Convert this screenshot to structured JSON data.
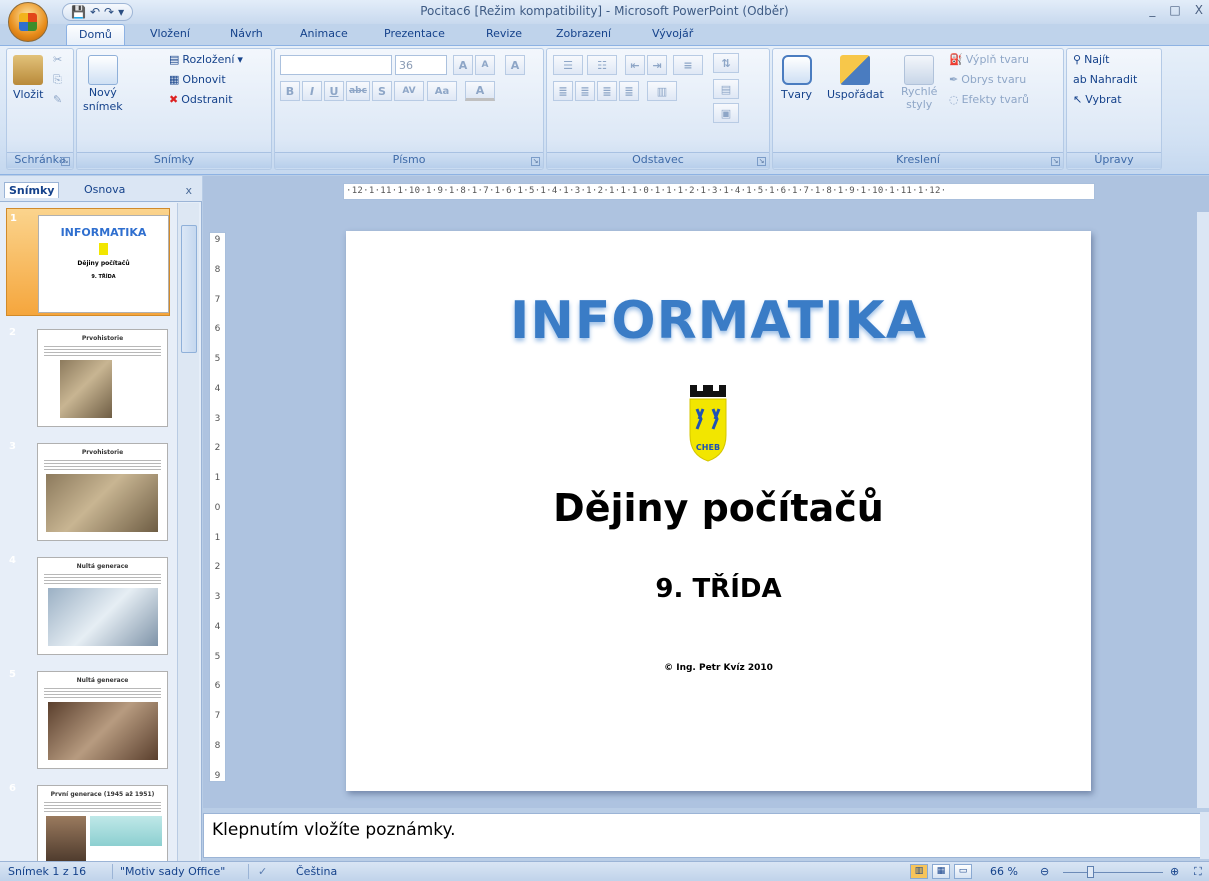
{
  "window": {
    "title": "Pocitac6 [Režim kompatibility] - Microsoft PowerPoint (Odběr)",
    "controls": [
      "_",
      "□",
      "X"
    ],
    "qat": [
      "💾",
      "↶",
      "↷",
      "▾"
    ]
  },
  "tabs": [
    "Domů",
    "Vložení",
    "Návrh",
    "Animace",
    "Prezentace",
    "Revize",
    "Zobrazení",
    "Vývojář"
  ],
  "active_tab": "Domů",
  "ribbon": {
    "clipboard": {
      "title": "Schránka",
      "paste": "Vložit"
    },
    "slides": {
      "title": "Snímky",
      "new_slide_1": "Nový",
      "new_slide_2": "snímek",
      "layout": "Rozložení",
      "reset": "Obnovit",
      "delete": "Odstranit"
    },
    "font": {
      "title": "Písmo",
      "size": "36",
      "bold": "B",
      "italic": "I",
      "underline": "U",
      "strike": "abc",
      "shadow": "S",
      "spacing": "AV",
      "case": "Aa",
      "grow": "A",
      "shrink": "A",
      "clear": "A",
      "color": "A"
    },
    "paragraph": {
      "title": "Odstavec"
    },
    "drawing": {
      "title": "Kreslení",
      "shapes": "Tvary",
      "arrange": "Uspořádat",
      "quick_styles_1": "Rychlé",
      "quick_styles_2": "styly",
      "fill": "Výplň tvaru",
      "outline": "Obrys tvaru",
      "effects": "Efekty tvarů"
    },
    "editing": {
      "title": "Úpravy",
      "find": "Najít",
      "replace": "Nahradit",
      "select": "Vybrat"
    }
  },
  "left_pane": {
    "tab_slides": "Snímky",
    "tab_outline": "Osnova",
    "close": "x",
    "thumbnails": [
      {
        "num": "1",
        "title": "INFORMATIKA",
        "subtitle": "Dějiny počítačů",
        "class": "9. TŘÍDA"
      },
      {
        "num": "2",
        "title": "Prvohistorie"
      },
      {
        "num": "3",
        "title": "Prvohistorie"
      },
      {
        "num": "4",
        "title": "Nultá generace"
      },
      {
        "num": "5",
        "title": "Nultá generace"
      },
      {
        "num": "6",
        "title": "První generace (1945 až 1951)"
      }
    ]
  },
  "ruler": {
    "horizontal": "·12·1·11·1·10·1·9·1·8·1·7·1·6·1·5·1·4·1·3·1·2·1·1·1·0·1·1·1·2·1·3·1·4·1·5·1·6·1·7·1·8·1·9·1·10·1·11·1·12·",
    "vertical": [
      "9",
      "8",
      "7",
      "6",
      "5",
      "4",
      "3",
      "2",
      "1",
      "0",
      "1",
      "2",
      "3",
      "4",
      "5",
      "6",
      "7",
      "8",
      "9"
    ]
  },
  "slide": {
    "title": "INFORMATIKA",
    "subtitle": "Dějiny počítačů",
    "class": "9. TŘÍDA",
    "copyright": "© Ing. Petr Kvíz 2010",
    "emblem_text": "CHEB"
  },
  "notes": {
    "placeholder": "Klepnutím vložíte poznámky."
  },
  "status": {
    "slide_info": "Snímek 1 z 16",
    "theme": "\"Motiv sady Office\"",
    "language": "Čeština",
    "zoom": "66 %"
  },
  "colors": {
    "title_blue": "#3a7cc6",
    "ribbon_text": "#15428b",
    "selected_thumb": "#f5a63d"
  }
}
